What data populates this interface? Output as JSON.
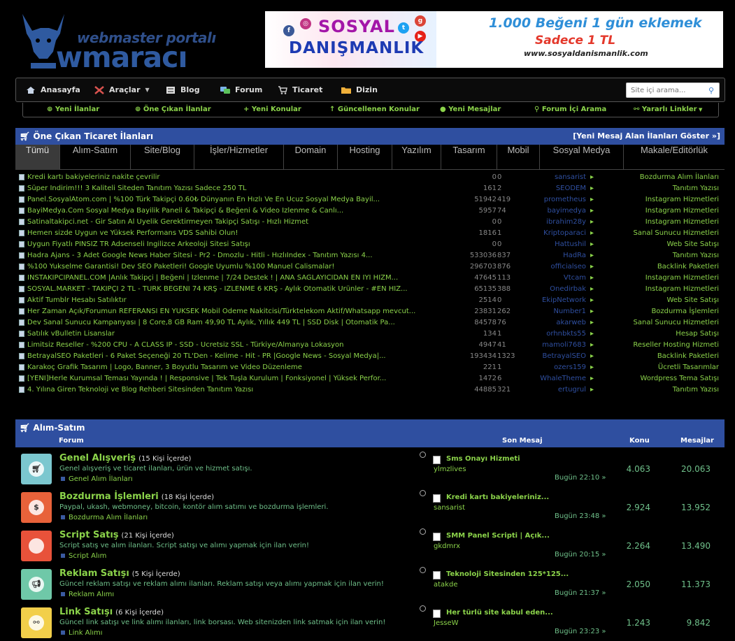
{
  "header": {
    "logo_small": "webmaster portalı",
    "logo_big": "wmaracı",
    "banner": {
      "brand_line1": "SOSYAL",
      "brand_line2": "DANIŞMANLIK",
      "headline": "1.000 Beğeni 1 gün eklemek",
      "price": "Sadece 1 TL",
      "url": "www.sosyaldanismanlik.com"
    }
  },
  "nav": {
    "items": [
      {
        "label": "Anasayfa",
        "icon": "home-icon"
      },
      {
        "label": "Araçlar",
        "icon": "tools-icon"
      },
      {
        "label": "Blog",
        "icon": "blog-icon"
      },
      {
        "label": "Forum",
        "icon": "forum-icon"
      },
      {
        "label": "Ticaret",
        "icon": "trade-icon"
      },
      {
        "label": "Dizin",
        "icon": "folder-icon"
      }
    ],
    "search_placeholder": "Site içi arama..."
  },
  "subnav": {
    "items": [
      {
        "label": "Yeni İlanlar",
        "icon": "plus-circle-icon"
      },
      {
        "label": "Öne Çıkan İlanlar",
        "icon": "plus-circle-icon"
      },
      {
        "label": "Yeni Konular",
        "icon": "plus-icon"
      },
      {
        "label": "Güncellenen Konular",
        "icon": "arrow-up-icon"
      },
      {
        "label": "Yeni Mesajlar",
        "icon": "comments-icon"
      },
      {
        "label": "Forum İçi Arama",
        "icon": "search-icon"
      },
      {
        "label": "Yararlı Linkler",
        "icon": "link-icon"
      }
    ]
  },
  "featured": {
    "title": "Öne Çıkan Ticaret İlanları",
    "right_link": "[Yeni Mesaj Alan İlanları Göster »]",
    "tabs": [
      "Tümü",
      "Alım-Satım",
      "Site/Blog",
      "İşler/Hizmetler",
      "Domain",
      "Hosting",
      "Yazılım",
      "Tasarım",
      "Mobil",
      "Sosyal Medya",
      "Makale/Editörlük"
    ],
    "active_tab": "Tümü",
    "rows": [
      {
        "title": "Kredi kartı bakiyeleriniz nakite çevrilir",
        "views": "0",
        "replies": "0",
        "user": "sansarist",
        "category": "Bozdurma Alım İlanları"
      },
      {
        "title": "Süper İndirim!!! 3 Kaliteli Siteden Tanıtım Yazısı Sadece 250 TL",
        "views": "161",
        "replies": "2",
        "user": "SEODEM",
        "category": "Tanıtım Yazısı"
      },
      {
        "title": "Panel.SosyalAtom.com | %100 Türk Takipçi 0.60₺ Dünyanın En Hızlı Ve En Ucuz Sosyal Medya Bayil...",
        "views": "51942",
        "replies": "419",
        "user": "prometheus",
        "category": "Instagram Hizmetleri"
      },
      {
        "title": "BayiMedya.Com Sosyal Medya Bayilik Paneli & Takipçi & Beğeni & Video İzlenme & Canlı...",
        "views": "5957",
        "replies": "74",
        "user": "bayimedya",
        "category": "Instagram Hizmetleri"
      },
      {
        "title": "Satinaltakipci.net - Gir Satın Al Üyelik Gerektirmeyen Takipçi Satışı - Hızlı Hizmet",
        "views": "0",
        "replies": "0",
        "user": "ibrahim28y",
        "category": "Instagram Hizmetleri"
      },
      {
        "title": "Hemen sizde Uygun ve Yüksek Performans VDS Sahibi Olun!",
        "views": "1816",
        "replies": "1",
        "user": "Kriptoparaci",
        "category": "Sanal Sunucu Hizmetleri"
      },
      {
        "title": "Uygun Fiyatlı PİNSİZ TR Adsenseli İngilizce Arkeoloji Sitesi Satışı",
        "views": "0",
        "replies": "0",
        "user": "Hattushil",
        "category": "Web Site Satışı"
      },
      {
        "title": "Hadra Ajans - 3 Adet Google News Haber Sitesi - Pr2 - Dmozlu - Hitli - HızlıIndex - Tanıtım Yazısı 4...",
        "views": "533036",
        "replies": "837",
        "user": "HadRa",
        "category": "Tanıtım Yazısı"
      },
      {
        "title": "%100 Yukselme Garantisi! Dev SEO Paketleri! Google Uyumlu %100 Manuel Calismalar!",
        "views": "296703",
        "replies": "876",
        "user": "officialseo",
        "category": "Backlink Paketleri"
      },
      {
        "title": "INSTAKIPCIPANEL.COM |Anlık Takipçi | Beğeni | İzlenme | 7/24 Destek ! | ANA SAĞLAYICIDAN EN İYİ HİZM...",
        "views": "47645",
        "replies": "113",
        "user": "Vtcam",
        "category": "Instagram Hizmetleri"
      },
      {
        "title": "SOSYAL.MARKET - TAKİPÇİ 2 TL - TÜRK BEĞENİ 74 KRŞ - İZLENME 6 KRŞ - Aylık Otomatik Ürünler - #EN HIZ...",
        "views": "65135",
        "replies": "388",
        "user": "Onedirbak",
        "category": "Instagram Hizmetleri"
      },
      {
        "title": "Aktif Tumblr Hesabı Satılıktır",
        "views": "2514",
        "replies": "0",
        "user": "EkipNetwork",
        "category": "Web Site Satışı"
      },
      {
        "title": "Her Zaman Açık/Forumun REFERANSI EN YÜKSEK Mobil Ödeme Nakitcisi/Türktelekom Aktif/Whatsapp mevcut...",
        "views": "23831",
        "replies": "262",
        "user": "Number1",
        "category": "Bozdurma İşlemleri"
      },
      {
        "title": "Dev Sanal Sunucu Kampanyası | 8 Core,8 GB Ram 49,90 TL Aylık, Yıllık 449 TL | SSD Disk | Otomatik Pa...",
        "views": "84578",
        "replies": "76",
        "user": "akarweb",
        "category": "Sanal Sunucu Hizmetleri"
      },
      {
        "title": "Satılık vBulletin Lisanslar",
        "views": "134",
        "replies": "1",
        "user": "orhnbkts55",
        "category": "Hesap Satışı"
      },
      {
        "title": "Limitsiz Reseller - %200 CPU - A CLASS IP - SSD - Ücretsiz SSL - Türkiye/Almanya Lokasyon",
        "views": "4947",
        "replies": "41",
        "user": "mamoli7683",
        "category": "Reseller Hosting Hizmeti"
      },
      {
        "title": "BetrayalSEO Paketleri - 6 Paket Seçeneği 20 TL'Den - Kelime - Hit - PR |Google News - Sosyal Medya|...",
        "views": "193434",
        "replies": "1323",
        "user": "BetrayalSEO",
        "category": "Backlink Paketleri"
      },
      {
        "title": "Karakoç Grafik Tasarım | Logo, Banner, 3 Boyutlu Tasarım ve Video Düzenleme",
        "views": "221",
        "replies": "1",
        "user": "ozers159",
        "category": "Ücretli Tasarımlar"
      },
      {
        "title": "[YENİ]Herle Kurumsal Teması Yayında ! | Responsive | Tek Tuşla Kurulum | Fonksiyonel | Yüksek Perfor...",
        "views": "1472",
        "replies": "6",
        "user": "WhaleTheme",
        "category": "Wordpress Tema Satışı"
      },
      {
        "title": "4. Yılına Giren Teknoloji ve Blog Rehberi Sitesinden Tanıtım Yazısı",
        "views": "44885",
        "replies": "321",
        "user": "ertugrul",
        "category": "Tanıtım Yazısı"
      }
    ]
  },
  "forum": {
    "title": "Alım-Satım",
    "columns": {
      "forum": "Forum",
      "last": "Son Mesaj",
      "topics": "Konu",
      "posts": "Mesajlar"
    },
    "rows": [
      {
        "title": "Genel Alışveriş",
        "count": "(15 Kişi İçerde)",
        "desc": "Genel alışveriş ve ticaret ilanları, ürün ve hizmet satışı.",
        "sub": "Genel Alım İlanları",
        "last_title": "Sms Onayı Hizmeti",
        "last_user": "ylmzlives",
        "last_date": "Bugün 22:10 »",
        "topics": "4.063",
        "posts": "20.063",
        "icon": "cart-icon",
        "color": "#7bc7cf"
      },
      {
        "title": "Bozdurma İşlemleri",
        "count": "(18 Kişi İçerde)",
        "desc": "Paypal, ukash, webmoney, bitcoin, kontör alım satımı ve bozdurma işlemleri.",
        "sub": "Bozdurma Alım İlanları",
        "last_title": "Kredi kartı bakiyeleriniz...",
        "last_user": "sansarist",
        "last_date": "Bugün 23:48 »",
        "topics": "2.924",
        "posts": "13.952",
        "icon": "money-icon",
        "color": "#e8623a"
      },
      {
        "title": "Script Satış",
        "count": "(21 Kişi İçerde)",
        "desc": "Script satış ve alım ilanları. Script satışı ve alımı yapmak için ilan verin!",
        "sub": "Script Alım",
        "last_title": "SMM Panel Scripti | Açık...",
        "last_user": "gkdmrx",
        "last_date": "Bugün 20:15 »",
        "topics": "2.264",
        "posts": "13.490",
        "icon": "code-icon",
        "color": "#e8523a"
      },
      {
        "title": "Reklam Satışı",
        "count": "(5 Kişi İçerde)",
        "desc": "Güncel reklam satışı ve reklam alımı ilanları. Reklam satışı veya alımı yapmak için ilan verin!",
        "sub": "Reklam Alımı",
        "last_title": "Teknoloji Sitesinden 125*125...",
        "last_user": "atakde",
        "last_date": "Bugün 21:37 »",
        "topics": "2.050",
        "posts": "11.373",
        "icon": "megaphone-icon",
        "color": "#6fc8a8"
      },
      {
        "title": "Link Satışı",
        "count": "(6 Kişi İçerde)",
        "desc": "Güncel link satışı ve link alımı ilanları, link borsası. Web sitenizden link satmak için ilan verin!",
        "sub": "Link Alımı",
        "last_title": "Her türlü site kabul eden...",
        "last_user": "JesseW",
        "last_date": "Bugün 23:23 »",
        "topics": "1.243",
        "posts": "9.842",
        "icon": "share-icon",
        "color": "#f2cf4a"
      }
    ]
  }
}
